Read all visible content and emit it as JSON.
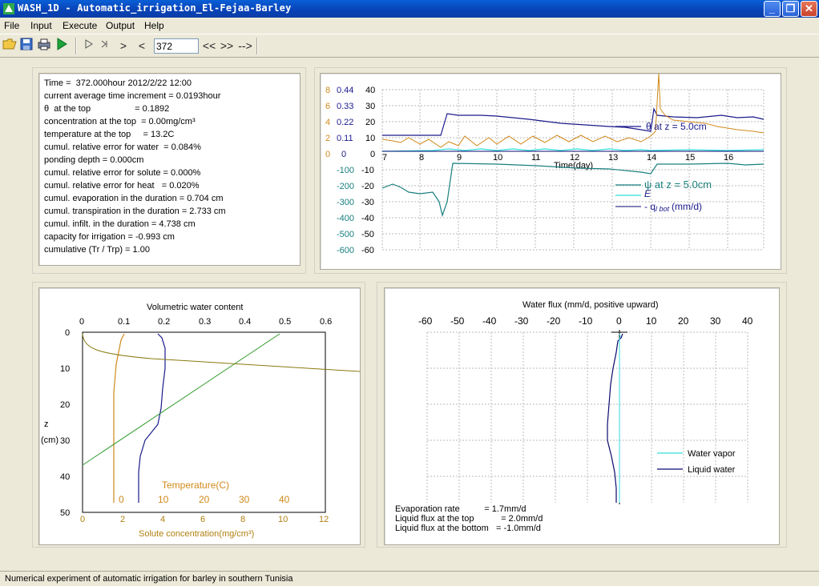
{
  "window": {
    "title": "WASH_1D - Automatic_irrigation_El-Fejaa-Barley",
    "minimize": "_",
    "maximize": "❐",
    "close": "✕"
  },
  "menu": [
    {
      "label": "File"
    },
    {
      "label": "Input"
    },
    {
      "label": "Execute"
    },
    {
      "label": "Output"
    },
    {
      "label": "Help"
    }
  ],
  "toolbar": {
    "time_value": "372",
    "step_back_label": "<",
    "step_forward_label": ">",
    "fast_back_label": "<<",
    "fast_forward_label": ">>",
    "go_end_label": "-->",
    "icons": [
      "open-folder-icon",
      "save-icon",
      "print-icon",
      "run-icon",
      "play-icon",
      "skip-forward-icon",
      "next-icon",
      "prev-icon"
    ]
  },
  "info": [
    "Time =  372.000hour 2012/2/22 12:00",
    "current average time increment = 0.0193hour",
    "θ  at the top                  = 0.1892",
    "concentration at the top  = 0.00mg/cm³",
    "temperature at the top     = 13.2C",
    "cumul. relative error for water  = 0.084%",
    "ponding depth = 0.000cm",
    "cumul. relative error for solute = 0.000%",
    "cumul. relative error for heat   = 0.020%",
    "cumul. evaporation in the duration = 0.704 cm",
    "cumul. transpiration in the duration = 2.733 cm",
    "cumul. infilt. in the duration = 4.738 cm",
    "capacity for irrigation = -0.993 cm",
    "cumulative (Tr / Trp) = 1.00"
  ],
  "colors": {
    "theta": "#1a1a8c",
    "temperature": "#d08a1a",
    "psi": "#1a7f7f",
    "evaporation": "#33dddd",
    "qbot": "#0a0a70",
    "solute": "#2a9a2a",
    "flux_liquid": "#0a0a70",
    "flux_vapor": "#33dddd",
    "olive": "#8a7a10"
  },
  "time_chart": {
    "xlabel": "Time(day)",
    "x_ticks": [
      "7",
      "8",
      "9",
      "10",
      "11",
      "12",
      "13",
      "14",
      "15",
      "16"
    ],
    "y_tick_cols": {
      "c1": [
        "8",
        "6",
        "4",
        "2",
        "0"
      ],
      "c2": [
        "0.44",
        "0.33",
        "0.22",
        "0.11",
        "0"
      ],
      "c3": [
        "40",
        "30",
        "20",
        "10",
        "0",
        "-10",
        "-20",
        "-30",
        "-40",
        "-50",
        "-60"
      ],
      "c4": [
        "-100",
        "-200",
        "-300",
        "-400",
        "-500",
        "-600"
      ]
    },
    "legend": {
      "theta": "θ at z = 5.0cm",
      "psi": "ψ at z = 5.0cm",
      "evap": "E",
      "qbot_prefix": "- q",
      "qbot_sub": "l bot",
      "qbot_unit": "(mm/d)"
    }
  },
  "profile_chart": {
    "title": "Volumetric water content",
    "top_ticks": [
      "0",
      "0.1",
      "0.2",
      "0.3",
      "0.4",
      "0.5",
      "0.6"
    ],
    "z_ticks": [
      "0",
      "10",
      "20",
      "30",
      "40",
      "50"
    ],
    "z_label": "z",
    "z_unit": "(cm)",
    "temp_label": "Temperature(C)",
    "temp_ticks": [
      "0",
      "10",
      "20",
      "30",
      "40"
    ],
    "solute_ticks": [
      "0",
      "2",
      "4",
      "6",
      "8",
      "10",
      "12"
    ],
    "solute_label": "Solute concentration(mg/cm³)"
  },
  "flux_chart": {
    "title": "Water flux (mm/d, positive upward)",
    "x_ticks": [
      "-60",
      "-50",
      "-40",
      "-30",
      "-20",
      "-10",
      "0",
      "10",
      "20",
      "30",
      "40"
    ],
    "legend_vapor": "Water vapor",
    "legend_liquid": "Liquid water",
    "evap_rate": "Evaporation rate          = 1.7mm/d",
    "flux_top": "Liquid flux at the top           = 2.0mm/d",
    "flux_bottom": "Liquid flux at the bottom   = -1.0mm/d"
  },
  "status": "Numerical experiment of automatic irrigation for barley in southern Tunisia"
}
